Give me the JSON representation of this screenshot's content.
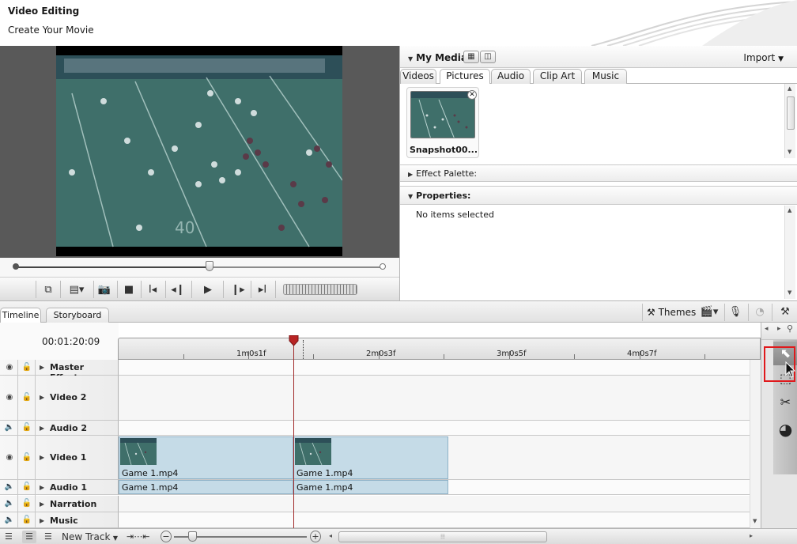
{
  "header": {
    "title": "Video Editing",
    "subtitle": "Create Your Movie"
  },
  "media": {
    "title": "My Media",
    "import_label": "Import",
    "tabs": [
      {
        "label": "Videos"
      },
      {
        "label": "Pictures"
      },
      {
        "label": "Audio"
      },
      {
        "label": "Clip Art"
      },
      {
        "label": "Music"
      }
    ],
    "active_tab": "Pictures",
    "items": [
      {
        "label": "Snapshot00..."
      }
    ]
  },
  "effect_palette": {
    "title": "Effect Palette:"
  },
  "properties": {
    "title": "Properties:",
    "empty_text": "No items selected"
  },
  "timeline_tabs": [
    {
      "label": "Timeline"
    },
    {
      "label": "Storyboard"
    }
  ],
  "active_timeline_tab": "Timeline",
  "toolbar": {
    "themes_label": "Themes"
  },
  "timeline": {
    "timecode": "00:01:20:09",
    "ruler_labels": [
      "1m0s1f",
      "2m0s3f",
      "3m0s5f",
      "4m0s7f"
    ],
    "tracks": [
      {
        "name": "Master Effects"
      },
      {
        "name": "Video 2"
      },
      {
        "name": "Audio 2"
      },
      {
        "name": "Video 1"
      },
      {
        "name": "Audio 1"
      },
      {
        "name": "Narration"
      },
      {
        "name": "Music"
      }
    ],
    "video1_clips": [
      {
        "label": "Game 1.mp4"
      },
      {
        "label": "Game 1.mp4"
      }
    ],
    "audio1_clips": [
      {
        "label": "Game 1.mp4"
      },
      {
        "label": "Game 1.mp4"
      }
    ]
  },
  "bottom_bar": {
    "new_track_label": "New Track"
  },
  "colors": {
    "playhead": "#a12b2b",
    "clip_fill": "#c5dbe7",
    "highlight_box": "#e0191c",
    "field_green": "#3f6f6a"
  },
  "icons": {
    "transport": [
      "toggle-view-icon",
      "layout-menu-icon",
      "snapshot-icon",
      "stop-icon",
      "mark-in-icon",
      "previous-frame-icon",
      "play-icon",
      "next-frame-icon",
      "mark-out-icon"
    ],
    "tools": [
      "select-tool-icon",
      "marquee-tool-icon",
      "razor-tool-icon",
      "speed-tool-icon"
    ]
  }
}
